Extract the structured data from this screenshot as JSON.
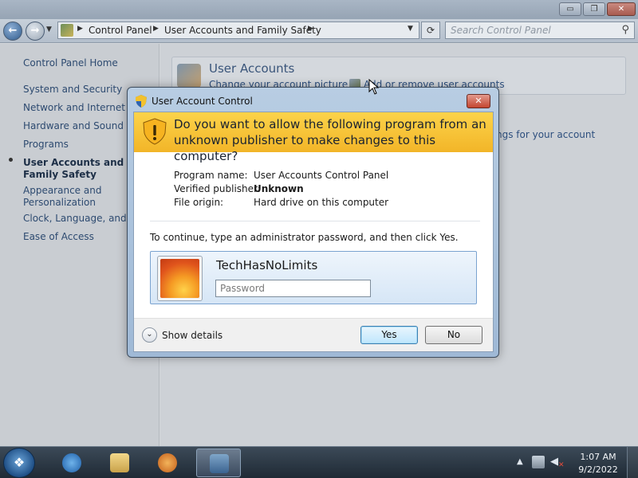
{
  "explorer": {
    "breadcrumb": [
      "Control Panel",
      "User Accounts and Family Safety"
    ],
    "search_placeholder": "Search Control Panel",
    "sidebar": {
      "home": "Control Panel Home",
      "items": [
        "System and Security",
        "Network and Internet",
        "Hardware and Sound",
        "Programs",
        "User Accounts and Family Safety",
        "Appearance and Personalization",
        "Clock, Language, and Region",
        "Ease of Access"
      ],
      "active_index": 4
    },
    "content": {
      "section_title": "User Accounts",
      "link_change_picture": "Change your account picture",
      "link_add_remove": "Add or remove user accounts",
      "link_partial": "ngs for your account"
    },
    "caption_buttons": {
      "minimize": "▭",
      "maximize": "❐",
      "close": "✕"
    }
  },
  "uac": {
    "title": "User Account Control",
    "close_glyph": "✕",
    "question": "Do you want to allow the following program from an unknown publisher to make changes to this computer?",
    "info": [
      {
        "label": "Program name:",
        "value": "User Accounts Control Panel"
      },
      {
        "label": "Verified publisher:",
        "value": "Unknown"
      },
      {
        "label": "File origin:",
        "value": "Hard drive on this computer"
      }
    ],
    "instruction": "To continue, type an administrator password, and then click Yes.",
    "username": "TechHasNoLimits",
    "password_placeholder": "Password",
    "show_details": "Show details",
    "yes_label": "Yes",
    "no_label": "No",
    "colors": {
      "banner": "#f6c232",
      "title_bar": "#b0c8e0",
      "yes_button_border": "#3c7fb1"
    }
  },
  "taskbar": {
    "clock_time": "1:07 AM",
    "clock_date": "9/2/2022",
    "items": [
      "start-orb-icon",
      "internet-explorer-icon",
      "windows-explorer-icon",
      "media-player-icon",
      "control-panel-icon"
    ]
  }
}
